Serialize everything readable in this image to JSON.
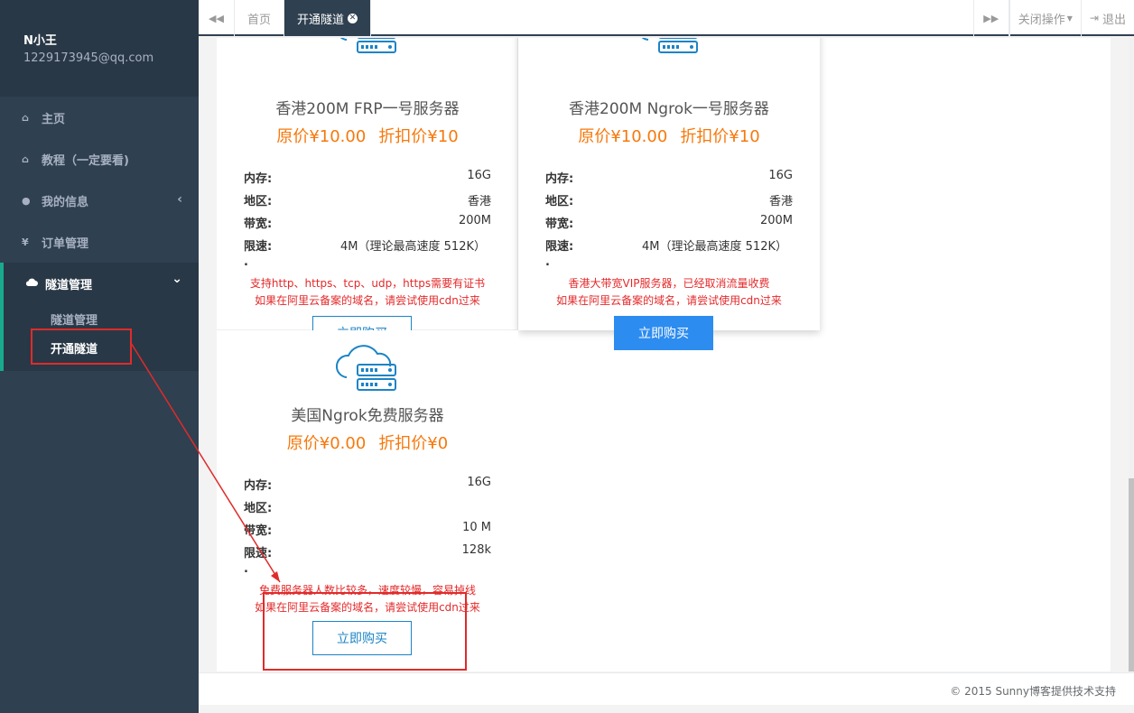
{
  "user": {
    "name": "N小王",
    "email": "1229173945@qq.com"
  },
  "sidebar": {
    "items": [
      {
        "label": "主页",
        "icon": "home-icon"
      },
      {
        "label": "教程（一定要看)",
        "icon": "home-icon"
      },
      {
        "label": "我的信息",
        "icon": "user-icon",
        "arrow": "‹"
      },
      {
        "label": "订单管理",
        "icon": "yen-icon"
      }
    ],
    "active_group": {
      "label": "隧道管理",
      "icon": "cloud-icon",
      "arrow": "⌄",
      "subitems": [
        {
          "label": "隧道管理"
        },
        {
          "label": "开通隧道"
        }
      ]
    }
  },
  "tabs": {
    "prev": "◀◀",
    "next": "▶▶",
    "items": [
      {
        "label": "首页"
      },
      {
        "label": "开通隧道",
        "close": "✕"
      }
    ],
    "close_ops": "关闭操作",
    "logout": "退出"
  },
  "cards": [
    {
      "title": "香港200M FRP一号服务器",
      "orig_price": "原价¥10.00",
      "disc_price": "折扣价¥10",
      "specs": [
        {
          "k": "内存:",
          "v": "16G"
        },
        {
          "k": "地区:",
          "v": "香港"
        },
        {
          "k": "带宽:",
          "v": "200M"
        },
        {
          "k": "限速:",
          "v": "4M（理论最高速度 512K）"
        }
      ],
      "dot": ".",
      "note1": "支持http、https、tcp、udp，https需要有证书",
      "note2": "如果在阿里云备案的域名，请尝试使用cdn过来",
      "buy": "立即购买"
    },
    {
      "title": "香港200M Ngrok一号服务器",
      "orig_price": "原价¥10.00",
      "disc_price": "折扣价¥10",
      "specs": [
        {
          "k": "内存:",
          "v": "16G"
        },
        {
          "k": "地区:",
          "v": "香港"
        },
        {
          "k": "带宽:",
          "v": "200M"
        },
        {
          "k": "限速:",
          "v": "4M（理论最高速度 512K）"
        }
      ],
      "dot": ".",
      "note1": "香港大带宽VIP服务器，已经取消流量收费",
      "note2": "如果在阿里云备案的域名，请尝试使用cdn过来",
      "buy": "立即购买"
    },
    {
      "title": "美国Ngrok免费服务器",
      "orig_price": "原价¥0.00",
      "disc_price": "折扣价¥0",
      "specs": [
        {
          "k": "内存:",
          "v": "16G"
        },
        {
          "k": "地区:",
          "v": ""
        },
        {
          "k": "带宽:",
          "v": "10 M"
        },
        {
          "k": "限速:",
          "v": "128k"
        }
      ],
      "dot": ".",
      "note1": "免费服务器人数比较多，速度较慢，容易掉线",
      "note2": "如果在阿里云备案的域名，请尝试使用cdn过来",
      "buy": "立即购买"
    }
  ],
  "footer": "© 2015 Sunny博客提供技术支持",
  "colors": {
    "accent": "#1c84c6",
    "price": "#f7780b",
    "note": "#e4292a",
    "sidebar": "#2f4050",
    "annotation": "#e02b2b"
  }
}
